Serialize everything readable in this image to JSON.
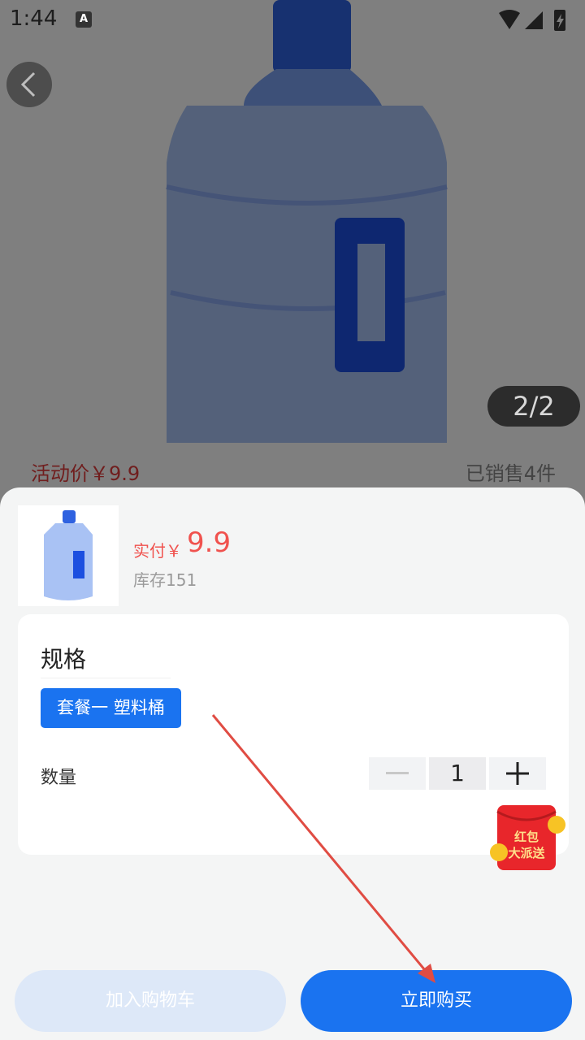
{
  "status_bar": {
    "time": "1:44",
    "a_icon": "A"
  },
  "product": {
    "image_counter": "2/2",
    "activity_price": "活动价￥9.9",
    "sold": "已销售4件"
  },
  "sheet": {
    "pay_label": "实付￥",
    "pay_value": "9.9",
    "stock": "库存151",
    "spec_title": "规格",
    "spec_option": "套餐一 塑料桶",
    "qty_label": "数量",
    "qty_value": "1",
    "red_packet_line1": "红包",
    "red_packet_line2": "大派送"
  },
  "actions": {
    "add_to_cart": "加入购物车",
    "buy_now": "立即购买"
  },
  "colors": {
    "accent": "#1a73f0",
    "price": "#f0524e",
    "cart_disabled": "#dde8f8"
  }
}
